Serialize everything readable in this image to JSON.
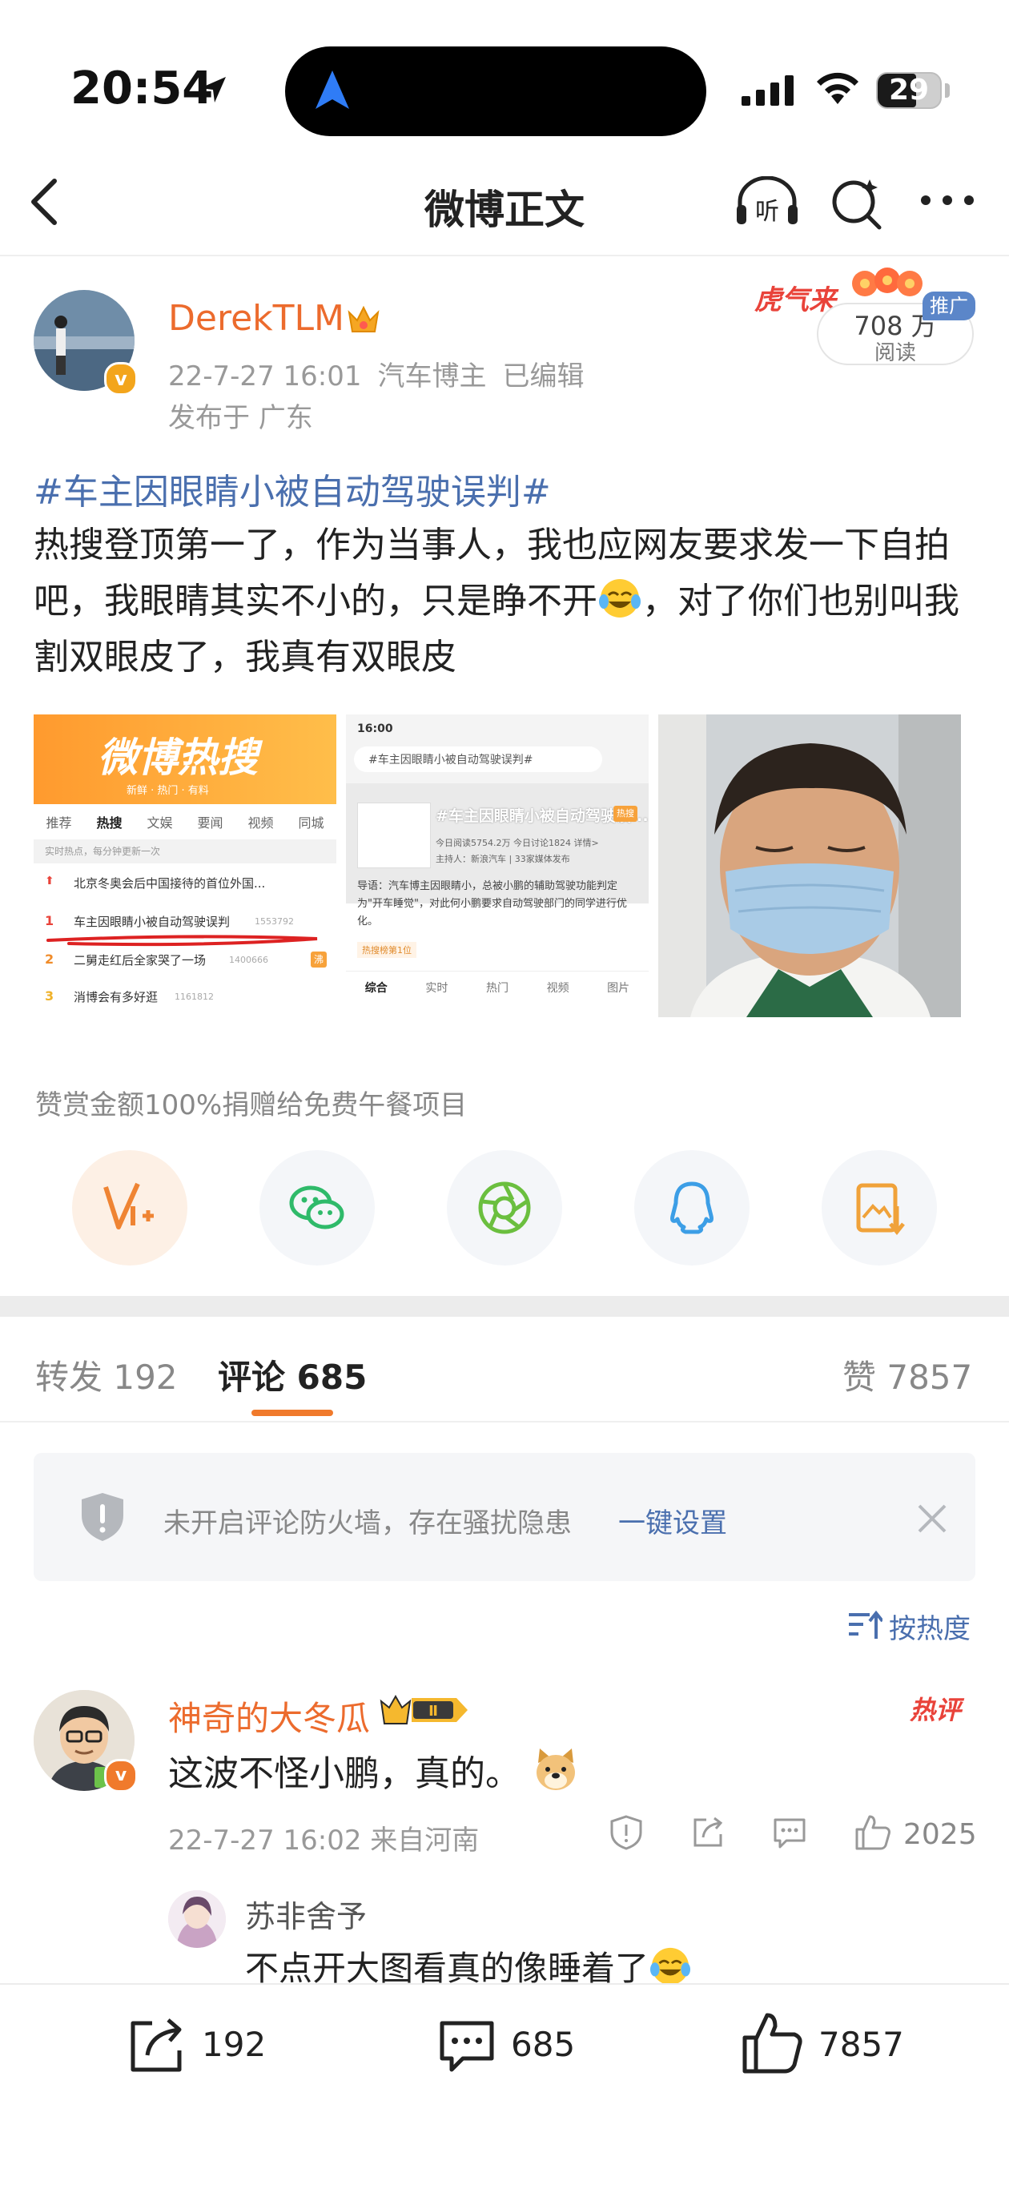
{
  "status": {
    "time": "20:54",
    "battery": "29"
  },
  "nav": {
    "title": "微博正文",
    "listen_label": "听"
  },
  "post": {
    "author": "DerekTLM",
    "verified_mark": "v",
    "date": "22-7-27 16:01",
    "role": "汽车博主",
    "edited": "已编辑",
    "location": "发布于 广东",
    "read_count": "708 万",
    "read_label": "阅读",
    "promo_tag": "推广",
    "promo_art_text": "虎气来",
    "hashtag": "#车主因眼睛小被自动驾驶误判#",
    "body_part1": "热搜登顶第一了，作为当事人，我也应网友要求发一下自拍吧，我眼睛其实不小的，只是睁不开",
    "body_part2": "，对了你们也别叫我割双眼皮了，我真有双眼皮"
  },
  "images": {
    "img1": {
      "banner": "微博热搜",
      "banner_sub": "新鲜 · 热门 · 有料",
      "tabs": [
        "推荐",
        "热搜",
        "文娱",
        "要闻",
        "视频",
        "同城"
      ],
      "update_note": "实时热点，每分钟更新一次",
      "rows": [
        {
          "rank": "⬆",
          "title": "北京冬奥会后中国接待的首位外国...",
          "count": "",
          "tag": ""
        },
        {
          "rank": "1",
          "title": "车主因眼睛小被自动驾驶误判",
          "count": "1553792",
          "tag": ""
        },
        {
          "rank": "2",
          "title": "二舅走红后全家哭了一场",
          "count": "1400666",
          "tag": "沸"
        },
        {
          "rank": "3",
          "title": "消博会有多好逛",
          "count": "1161812",
          "tag": ""
        }
      ]
    },
    "img2": {
      "time": "16:00",
      "search": "#车主因眼睛小被自动驾驶误判#",
      "topic": "#车主因眼睛小被自动驾驶误...",
      "topic_tag": "热搜",
      "stats": "今日阅读5754.2万 今日讨论1824 详情>",
      "host": "主持人：新浪汽车 | 33家媒体发布",
      "guide": "导语：汽车博主因眼睛小，总被小鹏的辅助驾驶功能判定为\"开车睡觉\"，对此何小鹏要求自动驾驶部门的同学进行优化。",
      "rank_chip": "热搜榜第1位",
      "tabs": [
        "综合",
        "实时",
        "热门",
        "视频",
        "图片"
      ]
    }
  },
  "donate_note": "赞赏金额100%捐赠给免费午餐项目",
  "share_icons": [
    "vplus-icon",
    "wechat-icon",
    "moments-icon",
    "qq-icon",
    "save-image-icon"
  ],
  "tabs": {
    "repost": "转发 192",
    "comments": "评论 685",
    "likes": "赞 7857"
  },
  "firewall": {
    "text": "未开启评论防火墙，存在骚扰隐患",
    "link": "一键设置"
  },
  "sort": {
    "label": "按热度"
  },
  "comment": {
    "name": "神奇的大冬瓜",
    "level_badge": "Ⅱ",
    "hot_tag": "热评",
    "text": "这波不怪小鹏，真的。",
    "meta": "22-7-27 16:02  来自河南",
    "likes": "2025"
  },
  "reply": {
    "name": "苏非舍予",
    "text": "不点开大图看真的像睡着了"
  },
  "bottom_bar": {
    "repost_count": "192",
    "comment_count": "685",
    "like_count": "7857"
  },
  "colors": {
    "brand_orange": "#ec6b2d",
    "link_blue": "#4a6fae",
    "tab_underline": "#f07a2c",
    "hot_red": "#e9433a"
  }
}
